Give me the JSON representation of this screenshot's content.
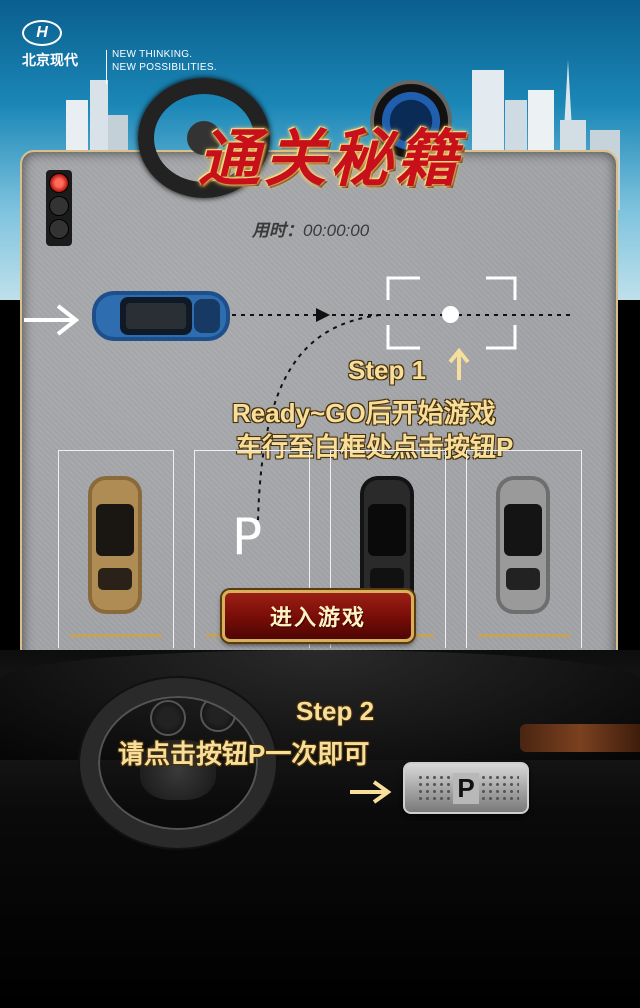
{
  "brand": {
    "logo": "H",
    "name": "北京现代",
    "slogan_line1": "NEW THINKING.",
    "slogan_line2": "NEW POSSIBILITIES."
  },
  "title": "通关秘籍",
  "timer": {
    "label": "用时：",
    "value": "00:00:00"
  },
  "step1": {
    "title": "Step 1",
    "line1": "Ready~GO后开始游戏",
    "line2": "车行至白框处点击按钮P"
  },
  "parking": {
    "p_marker": "P"
  },
  "enter_button": {
    "label": "进入游戏"
  },
  "step2": {
    "title": "Step 2",
    "line": "请点击按钮P一次即可"
  },
  "p_button": {
    "label": "P"
  },
  "colors": {
    "step_text": "#f7df9b",
    "enter_button_bg": "#7a0e08",
    "title_red": "#c8101a",
    "slot_line": "#c9a25a"
  },
  "icons": {
    "traffic_light": "traffic-light-icon",
    "arrow_in": "arrow-right-icon",
    "arrow_up": "arrow-up-icon"
  }
}
